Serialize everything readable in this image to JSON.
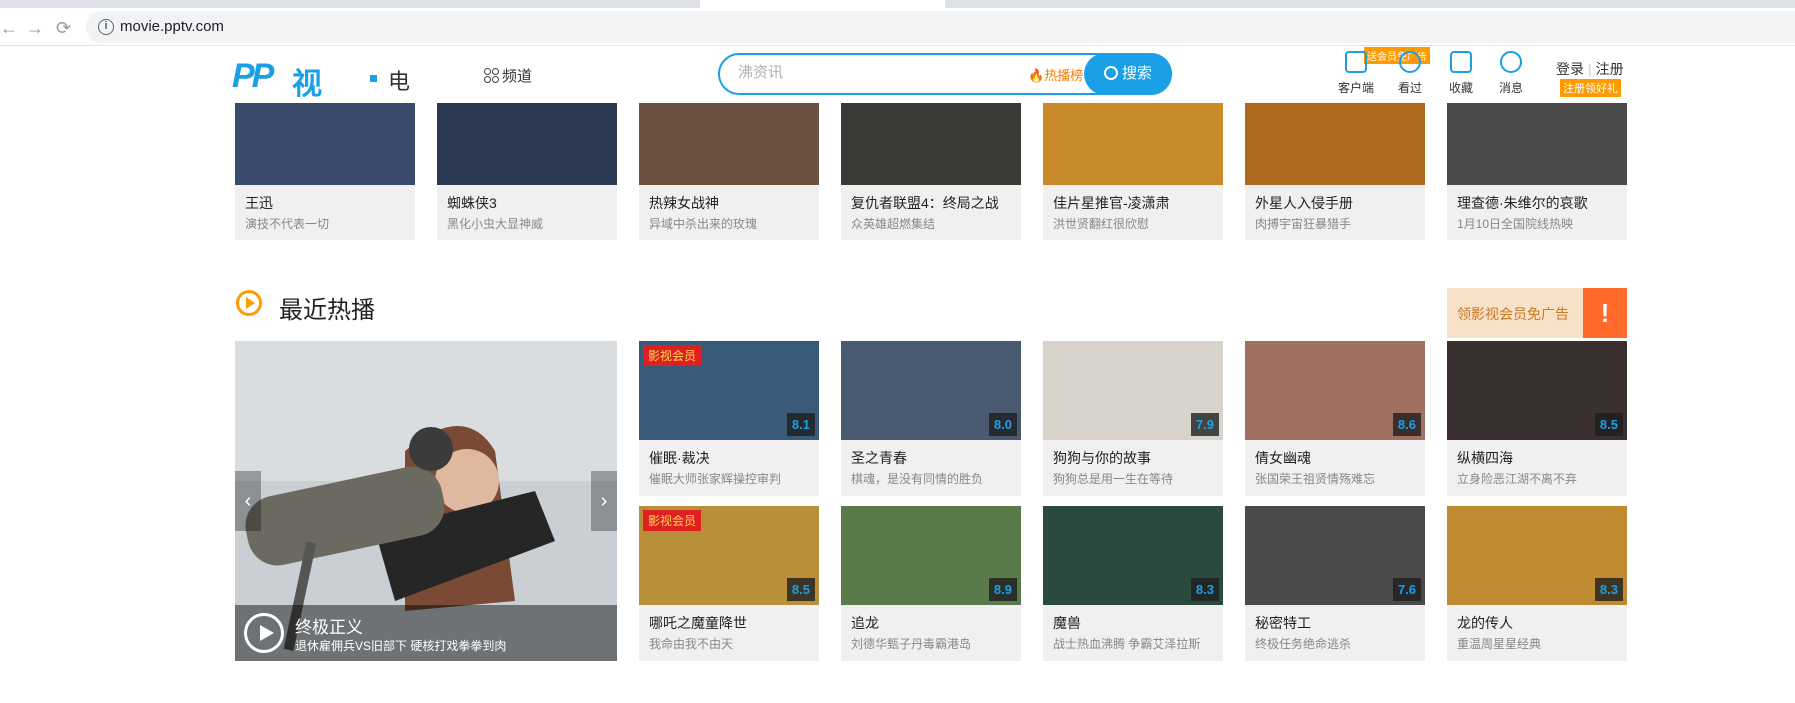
{
  "browser": {
    "url": "movie.pptv.com",
    "back_glyph": "←",
    "forward_glyph": "→",
    "reload_glyph": "⟳",
    "info_glyph": "i"
  },
  "header": {
    "logo_pp": "PP",
    "logo_video": "视频",
    "logo_section": "电影",
    "channel_label": "频道",
    "search_placeholder": "沸资讯",
    "hot_rank_label": "热播榜",
    "search_button": "搜索",
    "vip_promo": "送会员免广告",
    "icons": [
      {
        "label": "客户端",
        "icon": "monitor-icon"
      },
      {
        "label": "看过",
        "icon": "clock-icon"
      },
      {
        "label": "收藏",
        "icon": "bookmark-icon"
      },
      {
        "label": "消息",
        "icon": "message-icon"
      }
    ],
    "login": "登录",
    "register": "注册",
    "register_gift": "注册领好礼"
  },
  "top_strip": [
    {
      "title": "王迅",
      "subtitle": "演技不代表一切",
      "color": "#3a4a6a"
    },
    {
      "title": "蜘蛛侠3",
      "subtitle": "黑化小虫大显神威",
      "color": "#2b3a50"
    },
    {
      "title": "热辣女战神",
      "subtitle": "异域中杀出来的玫瑰",
      "color": "#6a5040"
    },
    {
      "title": "复仇者联盟4：终局之战",
      "subtitle": "众英雄超燃集结",
      "color": "#3a3a36"
    },
    {
      "title": "佳片星推官-凌潇肃",
      "subtitle": "洪世贤翻红很欣慰",
      "color": "#c98a2a"
    },
    {
      "title": "外星人入侵手册",
      "subtitle": "肉搏宇宙狂暴猎手",
      "color": "#b06a20"
    },
    {
      "title": "理查德·朱维尔的哀歌",
      "subtitle": "1月10日全国院线热映",
      "color": "#4a4a4a"
    }
  ],
  "section": {
    "title": "最近热播",
    "ad_text": "领影视会员免广告",
    "ad_glyph": "!"
  },
  "feature": {
    "title": "终极正义",
    "subtitle": "退休雇佣兵VS旧部下 硬核打戏拳拳到肉",
    "prev_glyph": "‹",
    "next_glyph": "›"
  },
  "grid": [
    {
      "title": "催眠·裁决",
      "subtitle": "催眠大师张家辉操控审判",
      "score": "8.1",
      "vip": "影视会员",
      "color": "#3a5a7a"
    },
    {
      "title": "圣之青春",
      "subtitle": "棋魂，是没有同情的胜负",
      "score": "8.0",
      "vip": "",
      "color": "#4a5a70"
    },
    {
      "title": "狗狗与你的故事",
      "subtitle": "狗狗总是用一生在等待",
      "score": "7.9",
      "vip": "",
      "color": "#d8d4cc"
    },
    {
      "title": "倩女幽魂",
      "subtitle": "张国荣王祖贤情殇难忘",
      "score": "8.6",
      "vip": "",
      "color": "#a07060"
    },
    {
      "title": "纵横四海",
      "subtitle": "立身险恶江湖不离不弃",
      "score": "8.5",
      "vip": "",
      "color": "#3a3030"
    },
    {
      "title": "哪吒之魔童降世",
      "subtitle": "我命由我不由天",
      "score": "8.5",
      "vip": "影视会员",
      "color": "#b8903a"
    },
    {
      "title": "追龙",
      "subtitle": "刘德华甄子丹毒霸港岛",
      "score": "8.9",
      "vip": "",
      "color": "#5a7a4a"
    },
    {
      "title": "魔兽",
      "subtitle": "战士热血沸腾 争霸艾泽拉斯",
      "score": "8.3",
      "vip": "",
      "color": "#2a4a40"
    },
    {
      "title": "秘密特工",
      "subtitle": "终极任务绝命逃杀",
      "score": "7.6",
      "vip": "",
      "color": "#4a4a4a"
    },
    {
      "title": "龙的传人",
      "subtitle": "重温周星星经典",
      "score": "8.3",
      "vip": "",
      "color": "#c08a30"
    }
  ]
}
